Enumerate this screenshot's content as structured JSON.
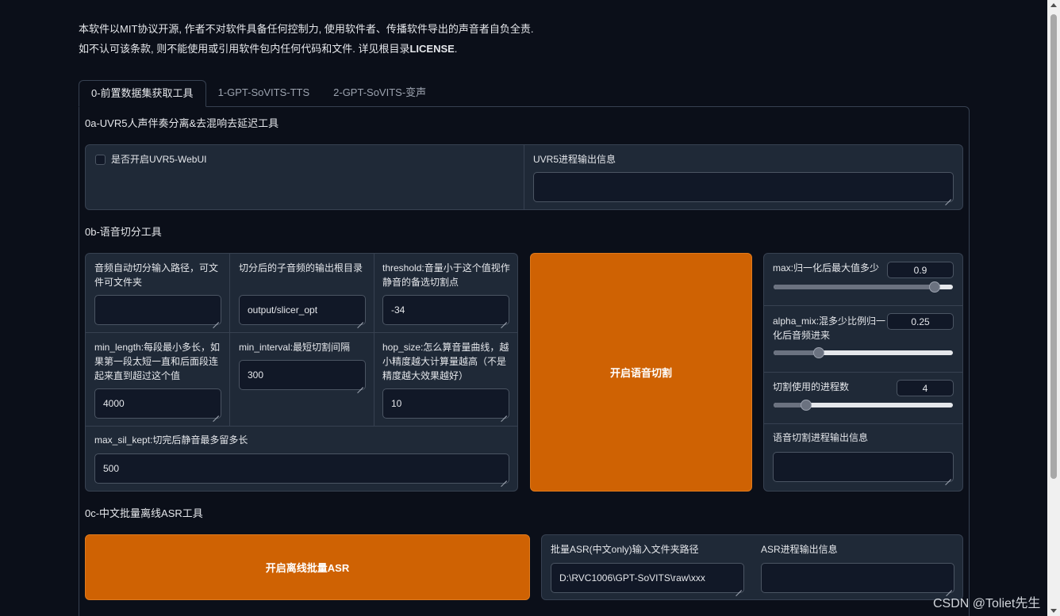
{
  "notice": {
    "line1": "本软件以MIT协议开源, 作者不对软件具备任何控制力, 使用软件者、传播软件导出的声音者自负全责.",
    "line2_prefix": "如不认可该条款, 则不能使用或引用软件包内任何代码和文件. 详见根目录",
    "line2_bold": "LICENSE",
    "line2_suffix": "."
  },
  "tabs": [
    {
      "label": "0-前置数据集获取工具",
      "active": true
    },
    {
      "label": "1-GPT-SoVITS-TTS",
      "active": false
    },
    {
      "label": "2-GPT-SoVITS-变声",
      "active": false
    }
  ],
  "uvr5": {
    "title": "0a-UVR5人声伴奏分离&去混响去延迟工具",
    "checkbox_label": "是否开启UVR5-WebUI",
    "output_label": "UVR5进程输出信息",
    "output_value": ""
  },
  "slicer": {
    "title": "0b-语音切分工具",
    "input_path_label": "音频自动切分输入路径，可文件可文件夹",
    "input_path_value": "",
    "output_root_label": "切分后的子音频的输出根目录",
    "output_root_value": "output/slicer_opt",
    "threshold_label": "threshold:音量小于这个值视作静音的备选切割点",
    "threshold_value": "-34",
    "min_length_label": "min_length:每段最小多长，如果第一段太短一直和后面段连起来直到超过这个值",
    "min_length_value": "4000",
    "min_interval_label": "min_interval:最短切割间隔",
    "min_interval_value": "300",
    "hop_size_label": "hop_size:怎么算音量曲线，越小精度越大计算量越高（不是精度越大效果越好）",
    "hop_size_value": "10",
    "max_sil_kept_label": "max_sil_kept:切完后静音最多留多长",
    "max_sil_kept_value": "500",
    "start_button": "开启语音切割",
    "max_label": "max:归一化后最大值多少",
    "max_value": "0.9",
    "max_fraction": 0.9,
    "alpha_mix_label": "alpha_mix:混多少比例归一化后音频进来",
    "alpha_mix_value": "0.25",
    "alpha_mix_fraction": 0.25,
    "n_process_label": "切割使用的进程数",
    "n_process_value": "4",
    "n_process_fraction": 0.18,
    "output_info_label": "语音切割进程输出信息",
    "output_info_value": ""
  },
  "asr": {
    "title": "0c-中文批量离线ASR工具",
    "start_button": "开启离线批量ASR",
    "input_dir_label": "批量ASR(中文only)输入文件夹路径",
    "input_dir_value": "D:\\RVC1006\\GPT-SoVITS\\raw\\xxx",
    "output_info_label": "ASR进程输出信息",
    "output_info_value": ""
  },
  "watermark": "CSDN @Toliet先生",
  "colors": {
    "background": "#0b0f19",
    "panel": "#1f2937",
    "border": "#374151",
    "accent_orange": "#cf6203"
  }
}
